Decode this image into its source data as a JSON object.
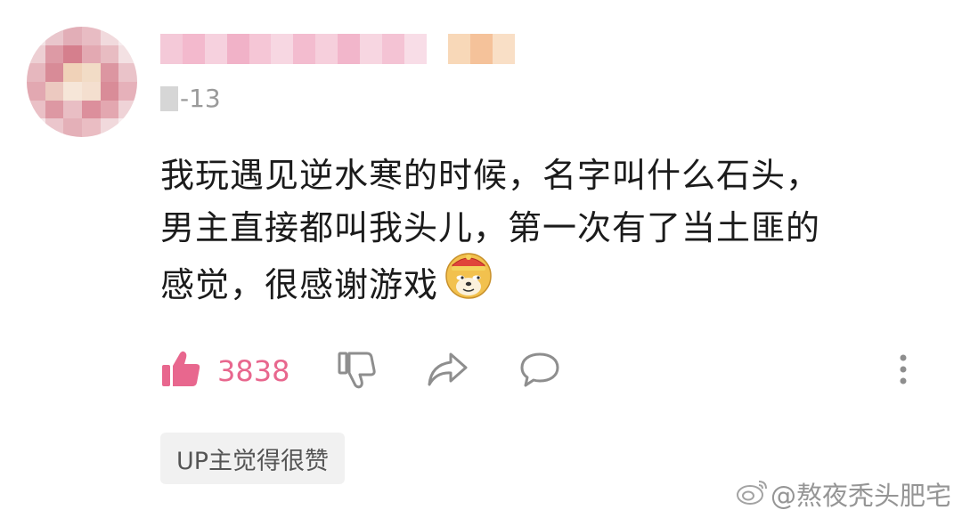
{
  "comment": {
    "date": "-13",
    "text_lines": [
      "我玩遇见逆水寒的时候，名字叫什么石头，",
      "男主直接都叫我头儿，第一次有了当土匪的",
      "感觉，很感谢游戏"
    ],
    "emoji": "doge-emoji",
    "like_count": "3838",
    "tag": "UP主觉得很赞"
  },
  "icons": {
    "like": "thumbs-up-icon",
    "dislike": "thumbs-down-icon",
    "share": "share-arrow-icon",
    "reply": "comment-bubble-icon",
    "more": "more-vertical-icon"
  },
  "colors": {
    "accent": "#e8678e",
    "icon_gray": "#8e8e8e"
  },
  "watermark": {
    "text": "@熬夜秃头肥宅"
  }
}
